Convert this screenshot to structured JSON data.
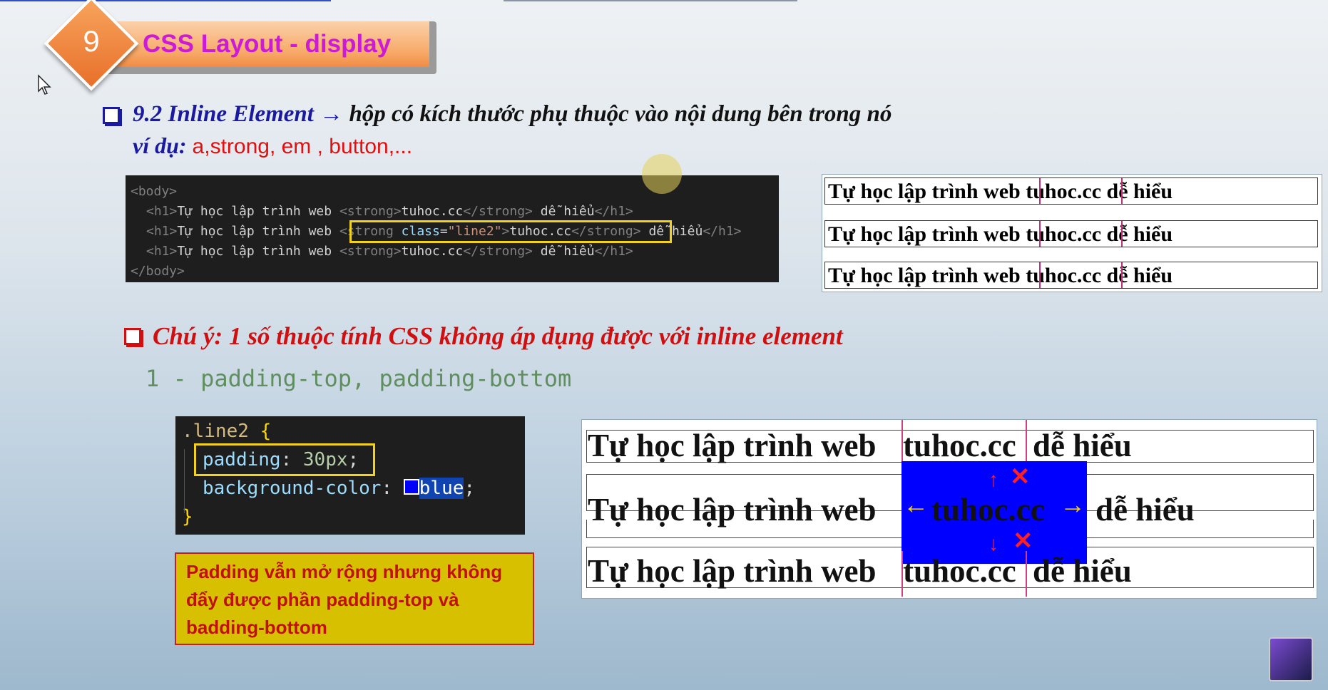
{
  "header": {
    "number": "9",
    "title": "CSS Layout - display"
  },
  "section": {
    "heading": "9.2 Inline Element",
    "arrow": "→",
    "description": "hộp có kích thước phụ thuộc vào nội dung bên trong nó",
    "example_label": "ví dụ:",
    "example_items": " a,strong, em , button,..."
  },
  "code1": {
    "line1": "<body>",
    "h1_open": "<h1>",
    "h1_text": "Tự học lập trình web ",
    "strong_open": "<strong>",
    "strong_class_open_a": "<strong ",
    "attr_name": "class",
    "attr_value": "\"line2\"",
    "strong_text": "tuhoc.cc",
    "strong_close": "</strong>",
    "after_text": " dễ hiểu",
    "h1_close": "</h1>",
    "line_last": "</body>"
  },
  "preview1": {
    "rows": [
      {
        "before": "Tự học lập trình web ",
        "strong": "tuhoc.cc",
        "after": " dễ hiểu"
      },
      {
        "before": "Tự học lập trình web ",
        "strong": "tuhoc.cc",
        "after": " dễ hiểu"
      },
      {
        "before": "Tự học lập trình web ",
        "strong": "tuhoc.cc",
        "after": " dễ hiểu"
      }
    ]
  },
  "note": {
    "heading": "Chú ý: 1 số thuộc tính CSS không áp dụng được với inline element",
    "item1": "1 - padding-top, padding-bottom"
  },
  "code2": {
    "selector": ".line2",
    "open_brace": " {",
    "prop1": "padding",
    "val1": "30px",
    "prop2": "background-color",
    "val2": "blue",
    "close_brace": "}"
  },
  "yellow_note": "Padding vẫn mở rộng nhưng không đẩy được phần padding-top và badding-bottom",
  "preview2": {
    "before": "Tự học lập trình web",
    "strong": "tuhoc.cc",
    "after": "dễ hiểu",
    "cross": "✕"
  },
  "colors": {
    "accent_orange": "#f08b45",
    "title_magenta": "#cc1bd6",
    "heading_blue": "#1a1aa0",
    "note_red": "#d01010"
  }
}
